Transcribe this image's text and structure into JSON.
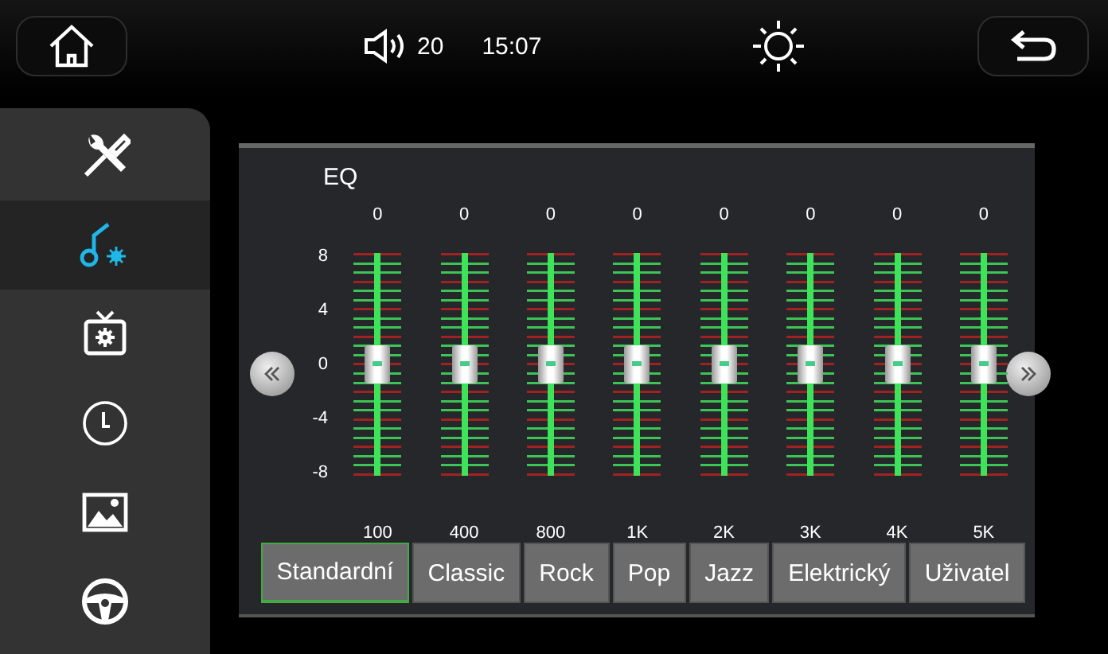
{
  "topbar": {
    "volume": "20",
    "time": "15:07"
  },
  "sidebar": {
    "items": [
      {
        "kind": "tools",
        "selected": false
      },
      {
        "kind": "sound",
        "selected": true
      },
      {
        "kind": "tv",
        "selected": false
      },
      {
        "kind": "clock",
        "selected": false
      },
      {
        "kind": "image",
        "selected": false
      },
      {
        "kind": "wheel",
        "selected": false
      }
    ]
  },
  "eq": {
    "title": "EQ",
    "scale": [
      "8",
      "4",
      "0",
      "-4",
      "-8"
    ],
    "bands": [
      {
        "value": "0",
        "freq": "100",
        "level": 0.5
      },
      {
        "value": "0",
        "freq": "400",
        "level": 0.5
      },
      {
        "value": "0",
        "freq": "800",
        "level": 0.5
      },
      {
        "value": "0",
        "freq": "1K",
        "level": 0.5
      },
      {
        "value": "0",
        "freq": "2K",
        "level": 0.5
      },
      {
        "value": "0",
        "freq": "3K",
        "level": 0.5
      },
      {
        "value": "0",
        "freq": "4K",
        "level": 0.5
      },
      {
        "value": "0",
        "freq": "5K",
        "level": 0.5
      }
    ],
    "presets": [
      {
        "label": "Standardní",
        "selected": true
      },
      {
        "label": "Classic",
        "selected": false
      },
      {
        "label": "Rock",
        "selected": false
      },
      {
        "label": "Pop",
        "selected": false
      },
      {
        "label": "Jazz",
        "selected": false
      },
      {
        "label": "Elektrický",
        "selected": false
      },
      {
        "label": "Uživatel",
        "selected": false
      }
    ]
  }
}
